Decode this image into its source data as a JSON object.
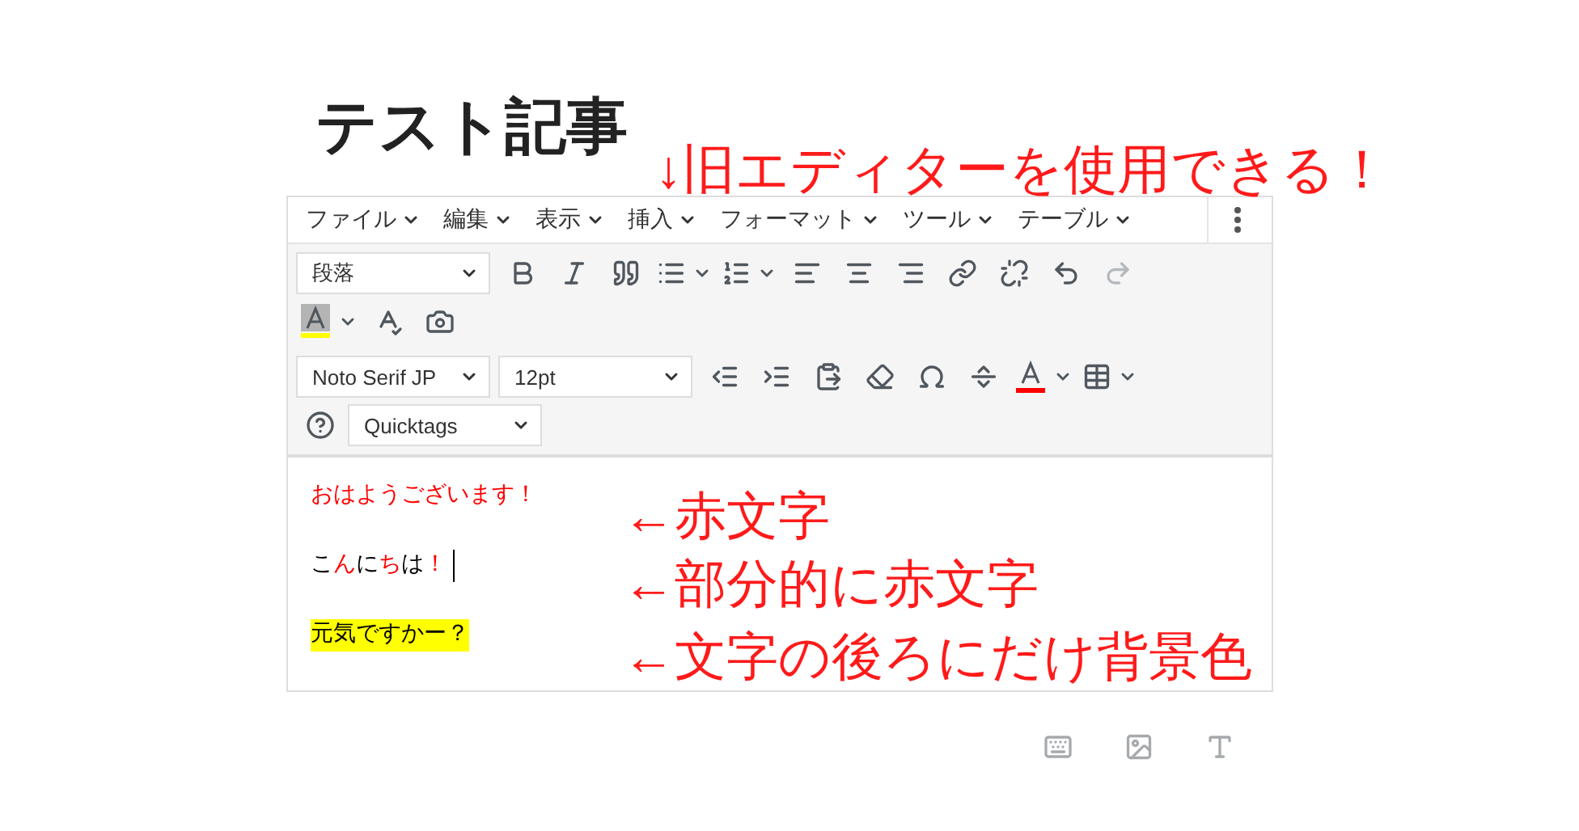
{
  "post_title": "テスト記事",
  "menu": [
    {
      "label": "ファイル"
    },
    {
      "label": "編集"
    },
    {
      "label": "表示"
    },
    {
      "label": "挿入"
    },
    {
      "label": "フォーマット"
    },
    {
      "label": "ツール"
    },
    {
      "label": "テーブル"
    }
  ],
  "format_select": {
    "value": "段落"
  },
  "font_select": {
    "value": "Noto Serif JP"
  },
  "size_select": {
    "value": "12pt"
  },
  "mode_select": {
    "value": "Quicktags"
  },
  "redo": {
    "disabled": true
  },
  "content": [
    {
      "segments": [
        {
          "text": "おはようございます！",
          "color": "#ff0000"
        }
      ],
      "cursor": false,
      "highlight": false
    },
    {
      "segments": [
        {
          "text": "こ",
          "color": "#000000"
        },
        {
          "text": "ん",
          "color": "#ff0000"
        },
        {
          "text": "に",
          "color": "#000000"
        },
        {
          "text": "ち",
          "color": "#ff0000"
        },
        {
          "text": "は",
          "color": "#000000"
        },
        {
          "text": "！",
          "color": "#ff0000"
        }
      ],
      "cursor": true,
      "highlight": false
    },
    {
      "segments": [
        {
          "text": "元気ですかー？",
          "color": "#000000"
        }
      ],
      "cursor": false,
      "highlight": true
    }
  ],
  "annotations": [
    {
      "text": "↓旧エディターを使用できる！"
    },
    {
      "text": "←赤文字"
    },
    {
      "text": "←部分的に赤文字"
    },
    {
      "text": "←文字の後ろにだけ背景色"
    }
  ]
}
